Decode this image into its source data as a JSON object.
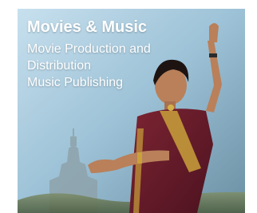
{
  "tile": {
    "title": "Movies & Music",
    "lines": [
      "Movie Production and",
      "Distribution",
      "Music Publishing"
    ],
    "image_subject": "dancer-photo"
  },
  "colors": {
    "caption_text": "#ffffff",
    "sky": "#9fc4d8",
    "sari": "#6a1f2a",
    "sari_border": "#c9a13b"
  }
}
